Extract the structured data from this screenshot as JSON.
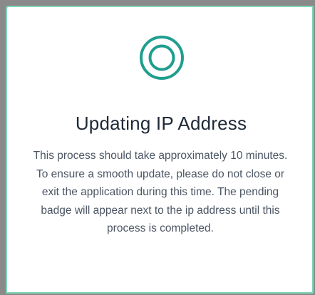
{
  "dialog": {
    "icon": "radio-target-icon",
    "title": "Updating IP Address",
    "message": "This process should take approximately 10 minutes. To ensure a smooth update, please do not close or exit the application during this time. The pending badge will appear next to the ip address until this process is completed."
  },
  "colors": {
    "accent": "#1f9e8f",
    "border": "#7fd6b4",
    "backdrop": "#8a8a8a",
    "title": "#1f2937",
    "body_text": "#4b5563"
  }
}
